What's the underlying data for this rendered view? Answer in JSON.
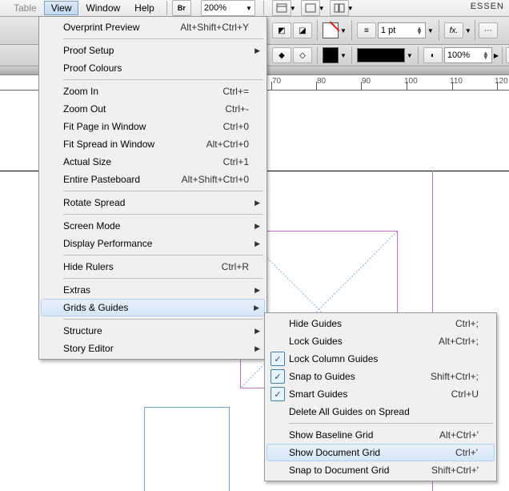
{
  "menubar": {
    "table": "Table",
    "view": "View",
    "window": "Window",
    "help": "Help"
  },
  "top": {
    "br": "Br",
    "zoom": "200%",
    "essen": "ESSEN"
  },
  "panel": {
    "pt": "1 pt",
    "pct": "100%"
  },
  "ruler": {
    "n70": "70",
    "n80": "80",
    "n90": "90",
    "n100": "100",
    "n110": "110",
    "n120": "120"
  },
  "view": {
    "overprint": "Overprint Preview",
    "overprint_sc": "Alt+Shift+Ctrl+Y",
    "proofsetup": "Proof Setup",
    "proofcolours": "Proof Colours",
    "zoomin": "Zoom In",
    "zoomin_sc": "Ctrl+=",
    "zoomout": "Zoom Out",
    "zoomout_sc": "Ctrl+-",
    "fitpage": "Fit Page in Window",
    "fitpage_sc": "Ctrl+0",
    "fitspread": "Fit Spread in Window",
    "fitspread_sc": "Alt+Ctrl+0",
    "actual": "Actual Size",
    "actual_sc": "Ctrl+1",
    "entire": "Entire Pasteboard",
    "entire_sc": "Alt+Shift+Ctrl+0",
    "rotate": "Rotate Spread",
    "screenmode": "Screen Mode",
    "display": "Display Performance",
    "hiderulers": "Hide Rulers",
    "hiderulers_sc": "Ctrl+R",
    "extras": "Extras",
    "grids": "Grids & Guides",
    "structure": "Structure",
    "story": "Story Editor"
  },
  "sub": {
    "hideguides": "Hide Guides",
    "hideguides_sc": "Ctrl+;",
    "lockguides": "Lock Guides",
    "lockguides_sc": "Alt+Ctrl+;",
    "lockcol": "Lock Column Guides",
    "snapguides": "Snap to Guides",
    "snapguides_sc": "Shift+Ctrl+;",
    "smart": "Smart Guides",
    "smart_sc": "Ctrl+U",
    "deleteall": "Delete All Guides on Spread",
    "baseline": "Show Baseline Grid",
    "baseline_sc": "Alt+Ctrl+'",
    "docgrid": "Show Document Grid",
    "docgrid_sc": "Ctrl+'",
    "snapdoc": "Snap to Document Grid",
    "snapdoc_sc": "Shift+Ctrl+'"
  }
}
